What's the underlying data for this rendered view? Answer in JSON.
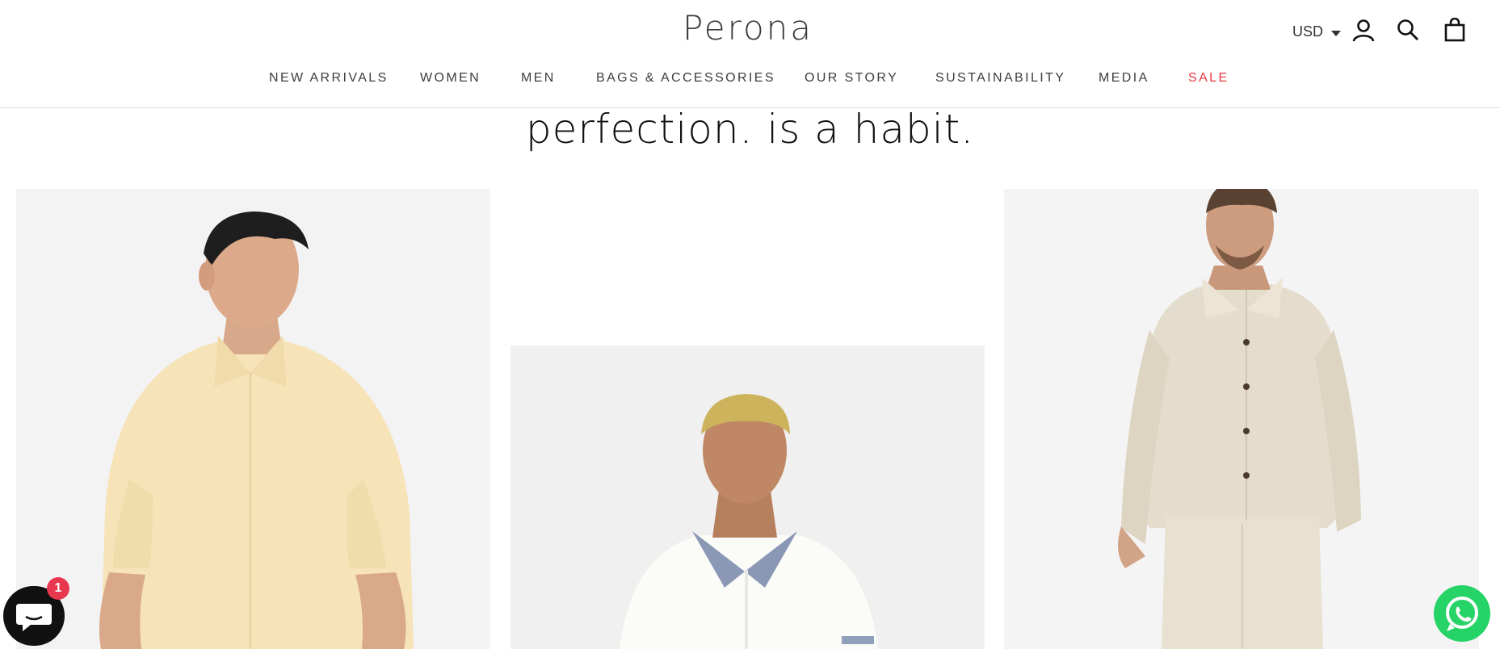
{
  "header": {
    "logo_text": "Perona",
    "currency": "USD",
    "icons": [
      "account-icon",
      "search-icon",
      "cart-icon"
    ]
  },
  "nav": {
    "items": [
      {
        "label": "NEW ARRIVALS"
      },
      {
        "label": "WOMEN"
      },
      {
        "label": "MEN"
      },
      {
        "label": "BAGS & ACCESSORIES"
      },
      {
        "label": "OUR STORY"
      },
      {
        "label": "SUSTAINABILITY"
      },
      {
        "label": "MEDIA"
      },
      {
        "label": "SALE"
      }
    ],
    "sale_color": "#e8383d"
  },
  "headline": "perfection. is a habit.",
  "products": [
    {
      "image": "man-in-cream-short-sleeve-shirt"
    },
    {
      "image": "man-in-white-polo-with-grey-collar"
    },
    {
      "image": "man-in-beige-linen-overshirt"
    }
  ],
  "chat": {
    "badge_count": "1",
    "color": "#111111"
  },
  "whatsapp": {
    "color": "#25d366"
  }
}
